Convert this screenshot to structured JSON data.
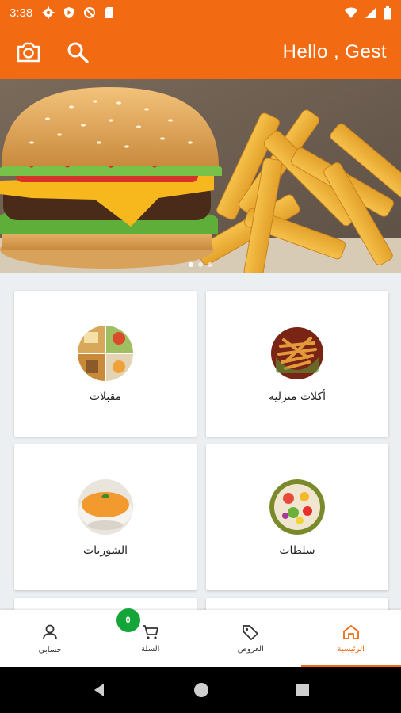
{
  "status_bar": {
    "time": "3:38",
    "left_icons": [
      "gear-icon",
      "play-protect-icon",
      "sync-off-icon",
      "sd-card-icon"
    ],
    "right_icons": [
      "wifi-icon",
      "signal-icon",
      "battery-icon"
    ]
  },
  "app_bar": {
    "greeting": "Hello , Gest",
    "icons": [
      "camera-icon",
      "search-icon"
    ]
  },
  "banner": {
    "slide_count": 3,
    "active_slide": 1
  },
  "categories": [
    {
      "label": "أكلات منزلية"
    },
    {
      "label": "مقبلات"
    },
    {
      "label": "سلطات"
    },
    {
      "label": "الشوربات"
    }
  ],
  "bottom_nav": {
    "items": [
      {
        "label": "الرئيسية",
        "icon": "home-icon",
        "active": true
      },
      {
        "label": "العروض",
        "icon": "tag-icon",
        "active": false
      },
      {
        "label": "السلة",
        "icon": "cart-icon",
        "active": false
      },
      {
        "label": "حسابي",
        "icon": "user-icon",
        "active": false
      }
    ],
    "cart_count": "0"
  },
  "colors": {
    "primary": "#f26a11",
    "badge": "#13a538",
    "background": "#eceff1"
  }
}
